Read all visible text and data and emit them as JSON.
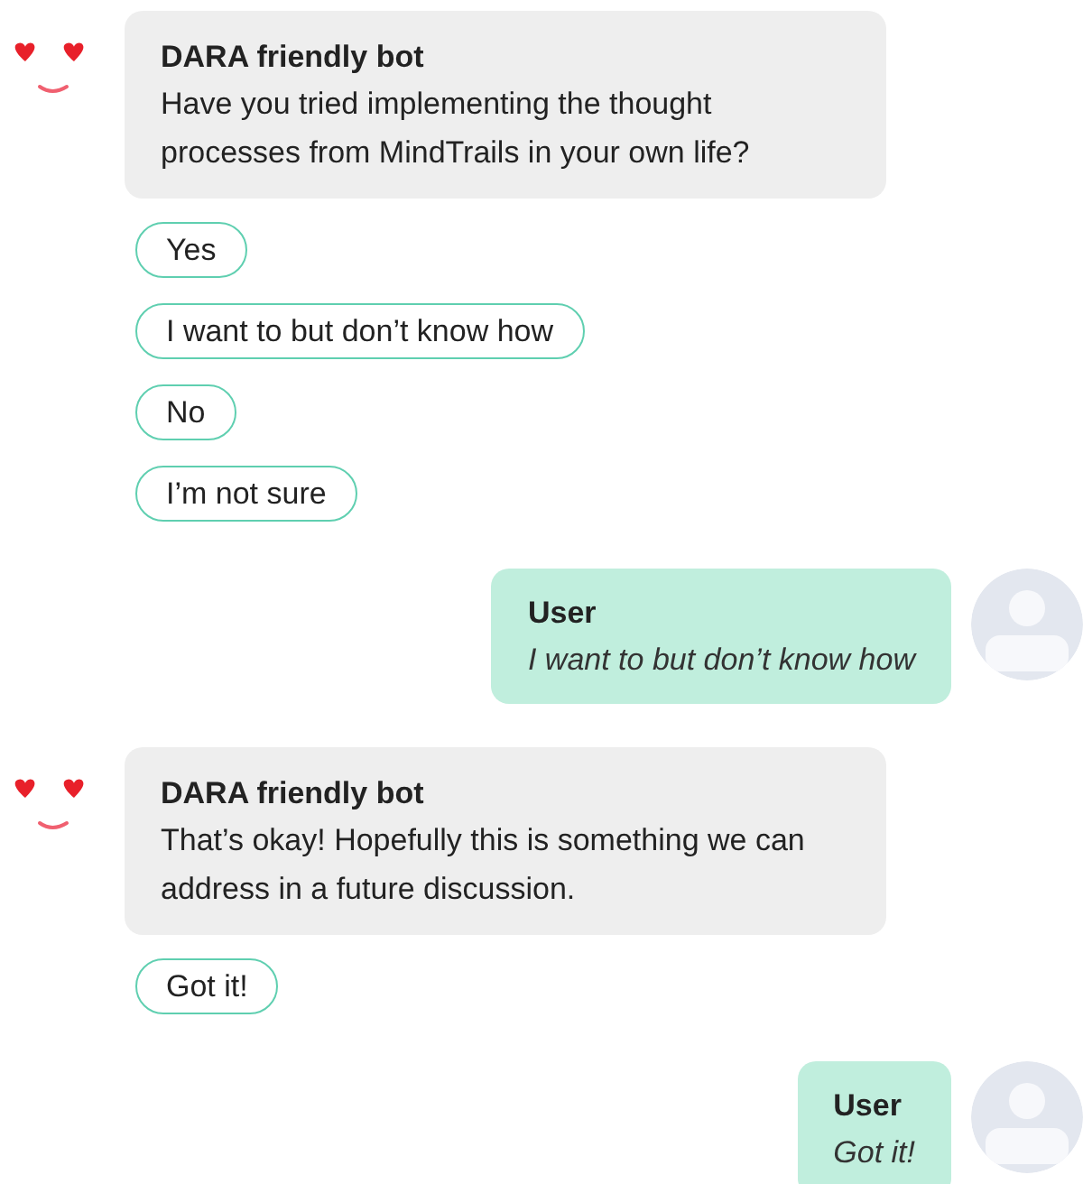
{
  "messages": [
    {
      "kind": "bot",
      "sender": "DARA friendly bot",
      "text": "Have you tried implementing the thought processes from MindTrails in your own life?",
      "options": [
        "Yes",
        "I want to but don’t know how",
        "No",
        "I’m not sure"
      ]
    },
    {
      "kind": "user",
      "sender": "User",
      "text": "I want to but don’t know how"
    },
    {
      "kind": "bot",
      "sender": "DARA friendly bot",
      "text": "That’s okay! Hopefully this is something we can address in a future discussion.",
      "options": [
        "Got it!"
      ]
    },
    {
      "kind": "user",
      "sender": "User",
      "text": "Got it!"
    }
  ]
}
